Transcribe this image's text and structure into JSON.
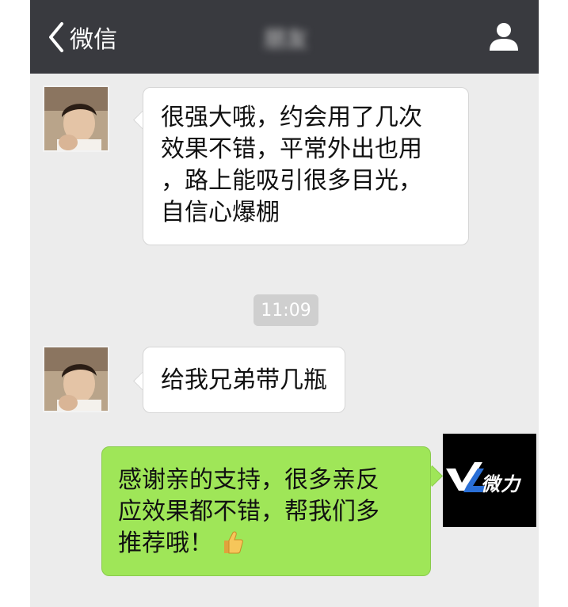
{
  "navbar": {
    "back_label": "微信",
    "chat_title": "朋友"
  },
  "messages": [
    {
      "side": "in",
      "text": "很强大哦，约会用了几次\n效果不错，平常外出也用\n，路上能吸引很多目光，\n自信心爆棚"
    },
    {
      "side": "in",
      "text": "给我兄弟带几瓶"
    },
    {
      "side": "out",
      "text": "感谢亲的支持，很多亲反\n应效果都不错，帮我们多\n推荐哦！"
    }
  ],
  "timestamp": "11:09",
  "logo": {
    "text": "微力"
  },
  "colors": {
    "navbar": "#393a3f",
    "background": "#ececec",
    "outgoing_bubble": "#9fe658",
    "incoming_bubble": "#ffffff"
  },
  "icons": [
    "chevron-left-icon",
    "profile-icon",
    "thumbs-up-icon"
  ]
}
